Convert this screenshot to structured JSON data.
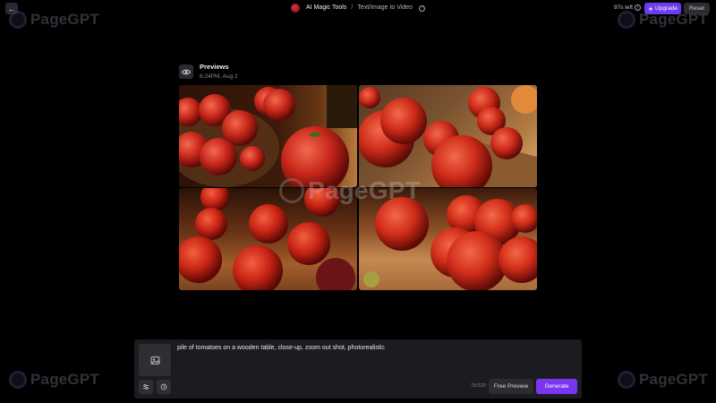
{
  "header": {
    "breadcrumb_main": "AI Magic Tools",
    "breadcrumb_sep": "/",
    "breadcrumb_sub": "Text/Image to Video",
    "help_glyph": "?",
    "credits": "97s left",
    "info_glyph": "i",
    "upgrade_label": "Upgrade",
    "reset_label": "Reset"
  },
  "watermark": {
    "text": "PageGPT"
  },
  "previews": {
    "title": "Previews",
    "timestamp": "6:24PM, Aug 2",
    "tiles": [
      {
        "name": "preview-image-1"
      },
      {
        "name": "preview-image-2"
      },
      {
        "name": "preview-image-3"
      },
      {
        "name": "preview-image-4"
      }
    ]
  },
  "prompt_panel": {
    "prompt_text": "pile of tomatoes on a wooden table, close-up, zoom out shot, photorealistic",
    "char_count": "75/320",
    "free_preview_label": "Free Preview",
    "generate_label": "Generate"
  },
  "colors": {
    "accent": "#7b34f0",
    "upgrade": "#6c3cf0",
    "background": "#000000",
    "panel": "#1c1c20"
  },
  "icons": {
    "back": "arrow-left-icon",
    "tool": "tool-logo-icon",
    "help": "question-circle-icon",
    "info": "info-circle-icon",
    "upgrade": "sparkle-icon",
    "eye": "eye-icon",
    "image_upload": "image-upload-icon",
    "settings": "sliders-icon",
    "history": "clock-icon"
  }
}
